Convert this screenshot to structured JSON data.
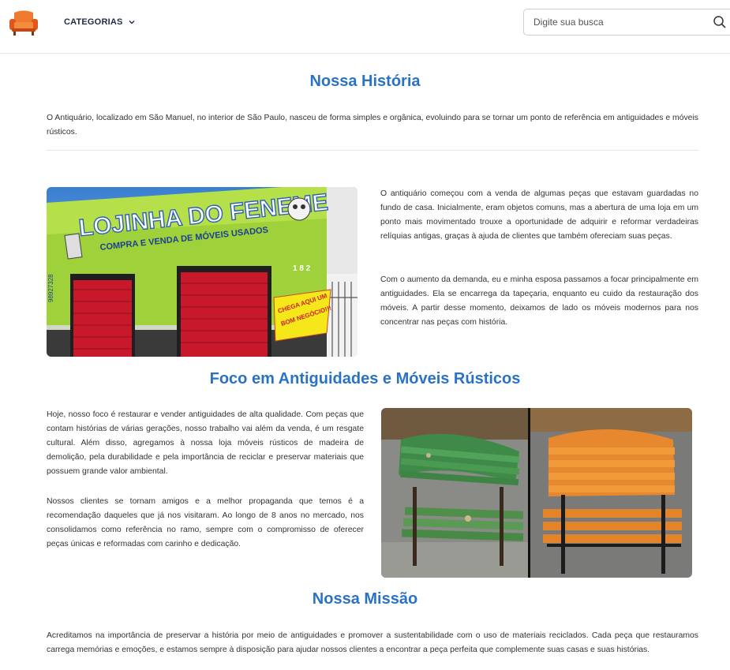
{
  "header": {
    "categories_label": "CATEGORIAS",
    "search_placeholder": "Digite sua busca",
    "accent_color": "#e0561f"
  },
  "sections": {
    "historia": {
      "title": "Nossa História",
      "intro": "O Antiquário, localizado em São Manuel, no interior de São Paulo, nasceu de forma simples e orgânica, evoluindo para se tornar um ponto de referência em antiguidades e móveis rústicos.",
      "paragraph1": "O antiquário começou com a venda de algumas peças que estavam guardadas no fundo de casa. Inicialmente, eram objetos comuns, mas a abertura de uma loja em um ponto mais movimentado trouxe a oportunidade de adquirir e reformar verdadeiras relíquias antigas, graças à ajuda de clientes que também ofereciam suas peças.",
      "paragraph2": "Com o aumento da demanda, eu e minha esposa passamos a focar principalmente em antiguidades. Ela se encarrega da tapeçaria, enquanto eu cuido da restauração dos móveis. A partir desse momento, deixamos de lado os móveis modernos para nos concentrar nas peças com história.",
      "store_sign": "LOJINHA DO FENEME",
      "store_subsign": "COMPRA E VENDA DE MÓVEIS USADOS",
      "store_number": "1 8 2",
      "store_badge_line1": "CHEGA AQUI UM",
      "store_badge_line2": "BOM NEGÓCIO!!!",
      "store_phone": "98927328"
    },
    "foco": {
      "title": "Foco em Antiguidades e Móveis Rústicos",
      "paragraph1": "Hoje, nosso foco é restaurar e vender antiguidades de alta qualidade. Com peças que contam histórias de várias gerações, nosso trabalho vai além da venda, é um resgate cultural. Além disso, agregamos à nossa loja móveis rústicos de madeira de demolição, pela durabilidade e pela importância de reciclar e preservar materiais que possuem grande valor ambiental.",
      "paragraph2": "Nossos clientes se tornam amigos e a melhor propaganda que temos é a recomendação daqueles que já nos visitaram. Ao longo de 8 anos no mercado, nos consolidamos como referência no ramo, sempre com o compromisso de oferecer peças únicas e reformadas com carinho e dedicação."
    },
    "missao": {
      "title": "Nossa Missão",
      "paragraph": "Acreditamos na importância de preservar a história por meio de antiguidades e promover a sustentabilidade com o uso de materiais reciclados. Cada peça que restauramos carrega memórias e emoções, e estamos sempre à disposição para ajudar nossos clientes a encontrar a peça perfeita que complemente suas casas e suas histórias."
    }
  }
}
